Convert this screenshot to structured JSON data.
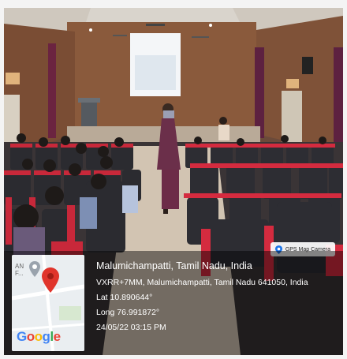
{
  "gps_badge": {
    "label": "GPS Map Camera",
    "icon": "gps-map-camera-icon"
  },
  "map_tile": {
    "fragment_text": "AN\nF...",
    "logo_text": "Google",
    "icons": [
      "map-pin-red-icon",
      "map-pin-grey-icon"
    ],
    "logo_colors": [
      "#4285F4",
      "#EA4335",
      "#FBBC05",
      "#4285F4",
      "#34A853",
      "#EA4335"
    ]
  },
  "location": {
    "title": "Malumichampatti, Tamil Nadu, India",
    "address": "VXRR+7MM, Malumichampatti, Tamil Nadu 641050, India",
    "lat": "Lat 10.890644°",
    "long": "Long 76.991872°",
    "datetime": "24/05/22 03:15 PM"
  }
}
